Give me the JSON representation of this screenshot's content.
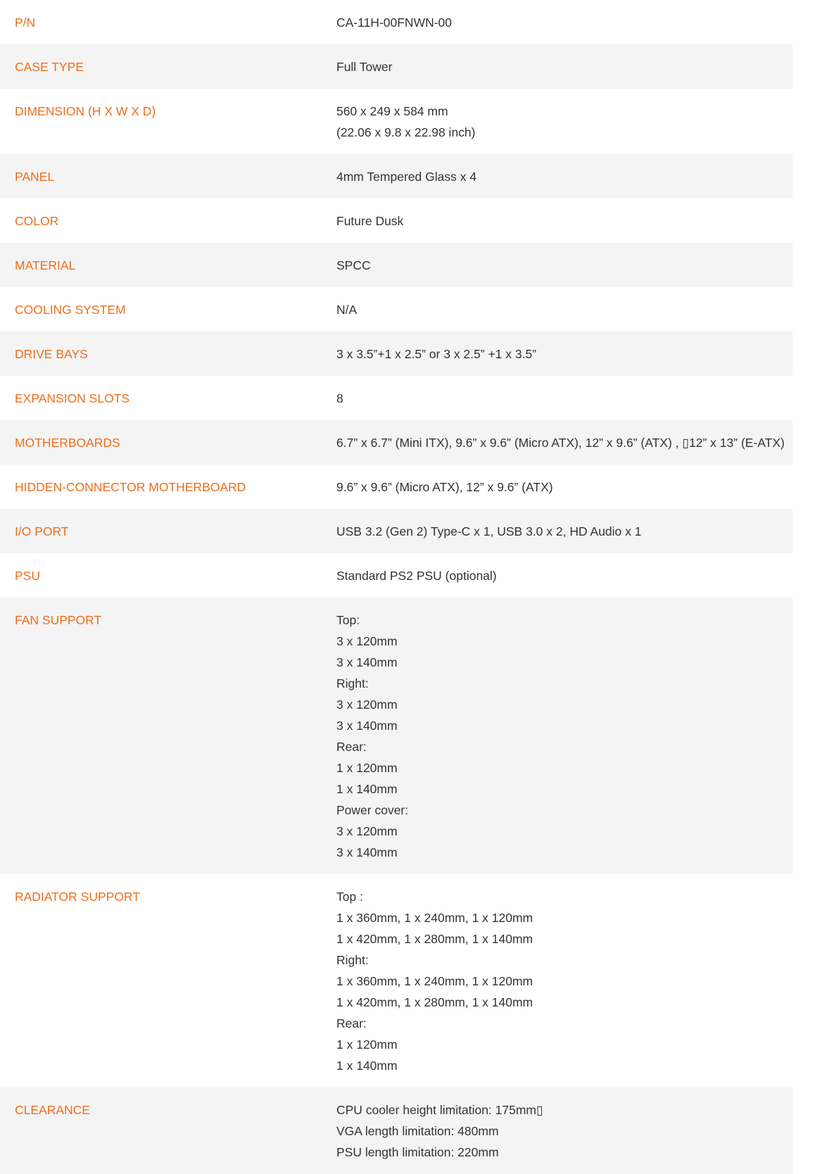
{
  "specs": [
    {
      "label": "P/N",
      "lines": [
        "CA-11H-00FNWN-00"
      ]
    },
    {
      "label": "CASE TYPE",
      "lines": [
        "Full Tower"
      ]
    },
    {
      "label": "DIMENSION (H X W X D)",
      "lines": [
        "560 x 249 x 584 mm",
        "(22.06 x 9.8 x 22.98 inch)"
      ]
    },
    {
      "label": "PANEL",
      "lines": [
        "4mm Tempered Glass x 4"
      ]
    },
    {
      "label": "COLOR",
      "lines": [
        "Future Dusk"
      ]
    },
    {
      "label": "MATERIAL",
      "lines": [
        "SPCC"
      ]
    },
    {
      "label": "COOLING SYSTEM",
      "lines": [
        "N/A"
      ]
    },
    {
      "label": "DRIVE BAYS",
      "lines": [
        "3 x 3.5”+1 x 2.5” or 3 x 2.5” +1 x 3.5”"
      ]
    },
    {
      "label": "EXPANSION SLOTS",
      "lines": [
        "8"
      ]
    },
    {
      "label": "MOTHERBOARDS",
      "lines": [
        "6.7” x 6.7” (Mini ITX), 9.6” x 9.6” (Micro ATX), 12” x 9.6” (ATX) , ▯12” x 13” (E-ATX)"
      ]
    },
    {
      "label": "HIDDEN-CONNECTOR MOTHERBOARD",
      "lines": [
        "9.6” x 9.6” (Micro ATX), 12” x 9.6” (ATX)"
      ]
    },
    {
      "label": "I/O PORT",
      "lines": [
        "USB 3.2 (Gen 2) Type-C x 1, USB 3.0 x 2, HD Audio x 1"
      ]
    },
    {
      "label": "PSU",
      "lines": [
        "Standard PS2 PSU (optional)"
      ]
    },
    {
      "label": "FAN SUPPORT",
      "lines": [
        "Top:",
        "3 x 120mm",
        "3 x 140mm",
        "Right:",
        "3 x 120mm",
        "3 x 140mm",
        "Rear:",
        "1 x 120mm",
        "1 x 140mm",
        "Power cover:",
        "3 x 120mm",
        "3 x 140mm"
      ]
    },
    {
      "label": "RADIATOR SUPPORT",
      "lines": [
        "Top :",
        "1 x 360mm, 1 x 240mm, 1 x 120mm",
        "1 x 420mm, 1 x 280mm, 1 x 140mm",
        "Right:",
        "1 x 360mm, 1 x 240mm, 1 x 120mm",
        "1 x 420mm, 1 x 280mm, 1 x 140mm",
        "Rear:",
        "1 x 120mm",
        "1 x 140mm"
      ]
    },
    {
      "label": "CLEARANCE",
      "lines": [
        "CPU cooler height limitation: 175mm▯",
        "VGA length limitation: 480mm",
        "PSU length limitation: 220mm"
      ]
    }
  ],
  "colors": {
    "label": "#f26c1a",
    "value": "#333333",
    "row_alt_background": "#f4f4f4",
    "row_background": "#ffffff"
  }
}
